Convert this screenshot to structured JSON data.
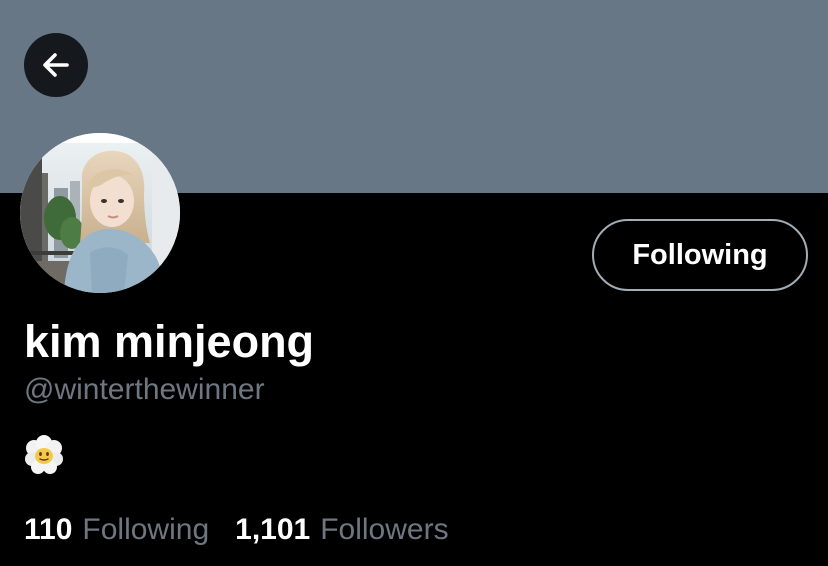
{
  "colors": {
    "banner": "#687785",
    "background": "#000000",
    "text_primary": "#ffffff",
    "text_secondary": "#6e7781",
    "button_border": "#a2adb6",
    "back_button_bg": "#15181c"
  },
  "header": {
    "back_icon": "arrow-left-icon"
  },
  "profile": {
    "avatar_icon": "profile-photo",
    "follow_button_label": "Following",
    "display_name": "kim minjeong",
    "handle": "@winterthewinner",
    "bio_emoji": "face-in-clouds-icon"
  },
  "stats": {
    "following_count": "110",
    "following_label": "Following",
    "followers_count": "1,101",
    "followers_label": "Followers"
  }
}
